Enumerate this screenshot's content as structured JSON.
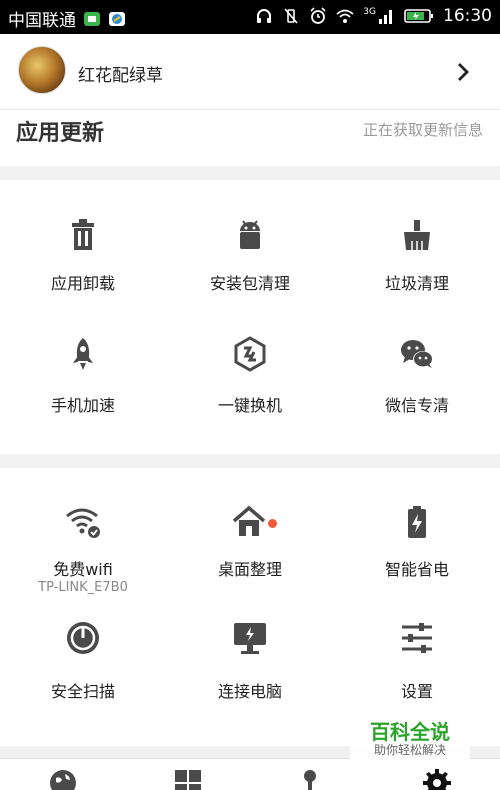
{
  "statusbar": {
    "carrier": "中国联通",
    "time": "16:30",
    "network": "3G"
  },
  "profile": {
    "name": "红花配绿草"
  },
  "update": {
    "title": "应用更新",
    "status": "正在获取更新信息"
  },
  "grid1": [
    {
      "label": "应用卸载",
      "icon": "trash-icon"
    },
    {
      "label": "安装包清理",
      "icon": "android-icon"
    },
    {
      "label": "垃圾清理",
      "icon": "broom-icon"
    },
    {
      "label": "手机加速",
      "icon": "rocket-icon"
    },
    {
      "label": "一键换机",
      "icon": "switch-phone-icon"
    },
    {
      "label": "微信专清",
      "icon": "wechat-icon"
    }
  ],
  "grid2": [
    {
      "label": "免费wifi",
      "sub": "TP-LINK_E7B0",
      "icon": "wifi-check-icon"
    },
    {
      "label": "桌面整理",
      "icon": "home-icon"
    },
    {
      "label": "智能省电",
      "icon": "battery-icon"
    },
    {
      "label": "安全扫描",
      "icon": "scan-icon"
    },
    {
      "label": "连接电脑",
      "icon": "monitor-icon"
    },
    {
      "label": "设置",
      "icon": "settings-sliders-icon"
    }
  ],
  "watermark": {
    "title": "百科全说",
    "subtitle": "助你轻松解决"
  },
  "colors": {
    "icon": "#4a4a4a",
    "badge": "#f05a3c",
    "watermark": "#2aa52a"
  }
}
